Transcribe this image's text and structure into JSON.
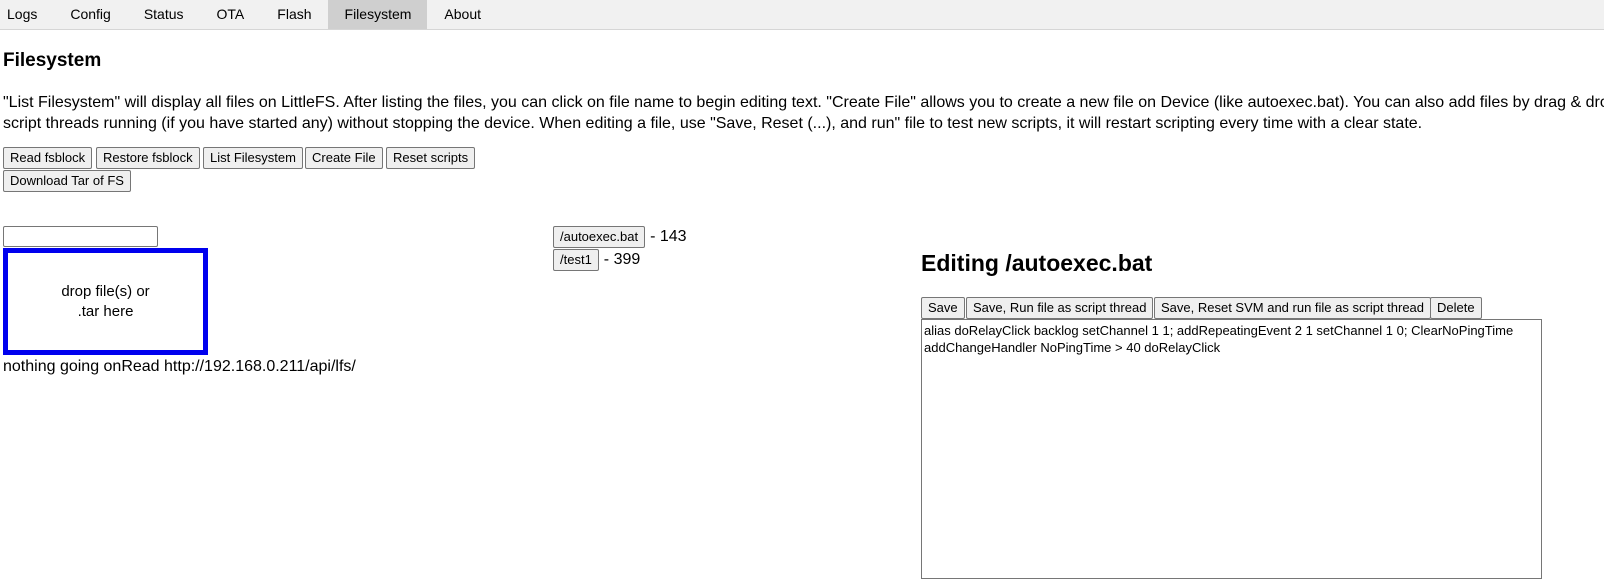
{
  "tabs": [
    {
      "label": "Logs"
    },
    {
      "label": "Config"
    },
    {
      "label": "Status"
    },
    {
      "label": "OTA"
    },
    {
      "label": "Flash"
    },
    {
      "label": "Filesystem",
      "active": true
    },
    {
      "label": "About"
    }
  ],
  "page": {
    "title": "Filesystem",
    "description_line1": "\"List Filesystem\" will display all files on LittleFS. After listing the files, you can click on file name to begin editing text. \"Create File\" allows you to create a new file on Device (like autoexec.bat). You can also add files by drag & drop",
    "description_line2": "script threads running (if you have started any) without stopping the device. When editing a file, use \"Save, Reset (...), and run\" file to test new scripts, it will restart scripting every time with a clear state."
  },
  "actions": {
    "read_fsblock": "Read fsblock",
    "restore_fsblock": "Restore fsblock",
    "list_filesystem": "List Filesystem",
    "create_file": "Create File",
    "reset_scripts": "Reset scripts",
    "download_tar": "Download Tar of FS"
  },
  "upload": {
    "input_value": "",
    "dropzone_line1": "drop file(s) or",
    "dropzone_line2": ".tar here",
    "status": "nothing going onRead http://192.168.0.211/api/lfs/"
  },
  "files": [
    {
      "name": "/autoexec.bat",
      "size": "- 143"
    },
    {
      "name": "/test1",
      "size": "- 399"
    }
  ],
  "editor": {
    "title": "Editing /autoexec.bat",
    "save": "Save",
    "save_run": "Save, Run file as script thread",
    "save_reset_run": "Save, Reset SVM and run file as script thread",
    "delete": "Delete",
    "content": "alias doRelayClick backlog setChannel 1 1; addRepeatingEvent 2 1 setChannel 1 0; ClearNoPingTime\naddChangeHandler NoPingTime > 40 doRelayClick"
  },
  "colors": {
    "tabbar_bg": "#f1f1f1",
    "tab_active_bg": "#cfcfcf",
    "dropzone_border": "#0000ee"
  }
}
